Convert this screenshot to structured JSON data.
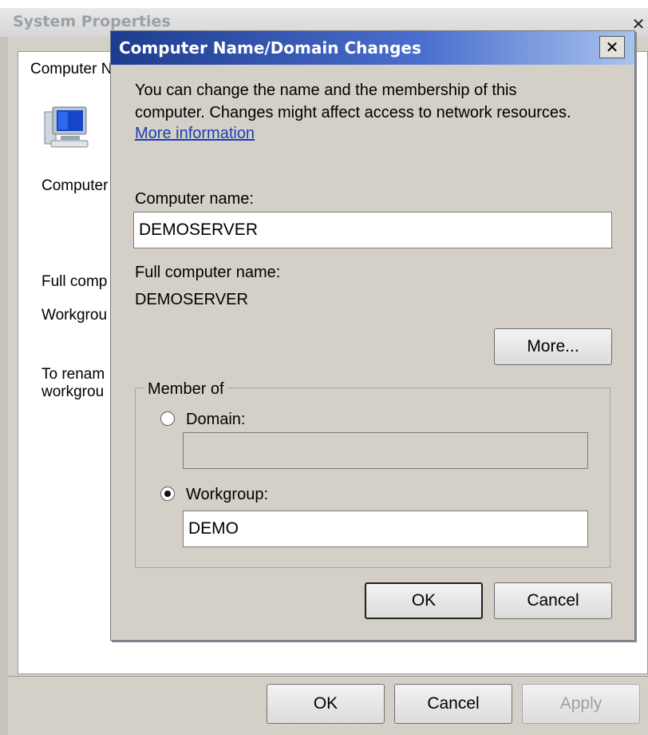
{
  "background_window": {
    "title": "System Properties",
    "close_glyph": "✕",
    "tab_label": "Computer N",
    "labels": {
      "computer_desc": "Computer",
      "full_comp": "Full comp",
      "workgroup": "Workgrou",
      "to_rename_line1": "To renam",
      "to_rename_line2": "workgrou"
    },
    "buttons": {
      "ok": "OK",
      "cancel": "Cancel",
      "apply": "Apply"
    }
  },
  "dialog": {
    "title": "Computer Name/Domain Changes",
    "close_glyph": "✕",
    "intro_line1": "You can change the name and the membership of this",
    "intro_line2": "computer. Changes might affect access to network resources.",
    "more_info_link": "More information",
    "computer_name_label": "Computer name:",
    "computer_name_value": "DEMOSERVER",
    "full_name_label": "Full computer name:",
    "full_name_value": "DEMOSERVER",
    "more_button": "More...",
    "member_of": {
      "legend": "Member of",
      "domain_label": "Domain:",
      "domain_value": "",
      "domain_selected": false,
      "workgroup_label": "Workgroup:",
      "workgroup_value": "DEMO",
      "workgroup_selected": true
    },
    "buttons": {
      "ok": "OK",
      "cancel": "Cancel"
    }
  },
  "colors": {
    "titlebar_start": "#1e3c8e",
    "titlebar_end": "#a9c3ee",
    "dialog_bg": "#d4d0c8",
    "link": "#1a3fb5"
  }
}
